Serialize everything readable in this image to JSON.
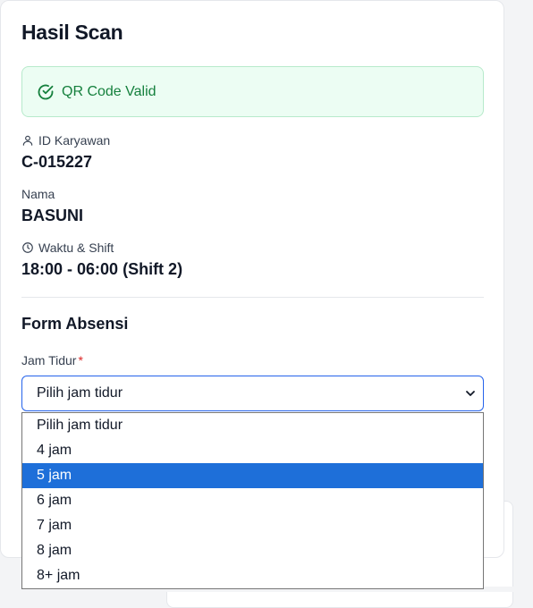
{
  "title": "Hasil Scan",
  "status": {
    "text": "QR Code Valid",
    "color": "#15803d"
  },
  "employee": {
    "id_label": "ID Karyawan",
    "id_value": "C-015227",
    "name_label": "Nama",
    "name_value": "BASUNI",
    "time_label": "Waktu & Shift",
    "time_value": "18:00 - 06:00 (Shift 2)"
  },
  "form": {
    "title": "Form Absensi",
    "sleep_label": "Jam Tidur",
    "required_mark": "*",
    "select_value": "Pilih jam tidur",
    "options": [
      "Pilih jam tidur",
      "4 jam",
      "5 jam",
      "6 jam",
      "7 jam",
      "8 jam",
      "8+ jam"
    ],
    "highlighted_option": "5 jam"
  },
  "colors": {
    "highlight": "#1e6fd9",
    "focus_border": "#2563eb",
    "required": "#dc2626"
  }
}
